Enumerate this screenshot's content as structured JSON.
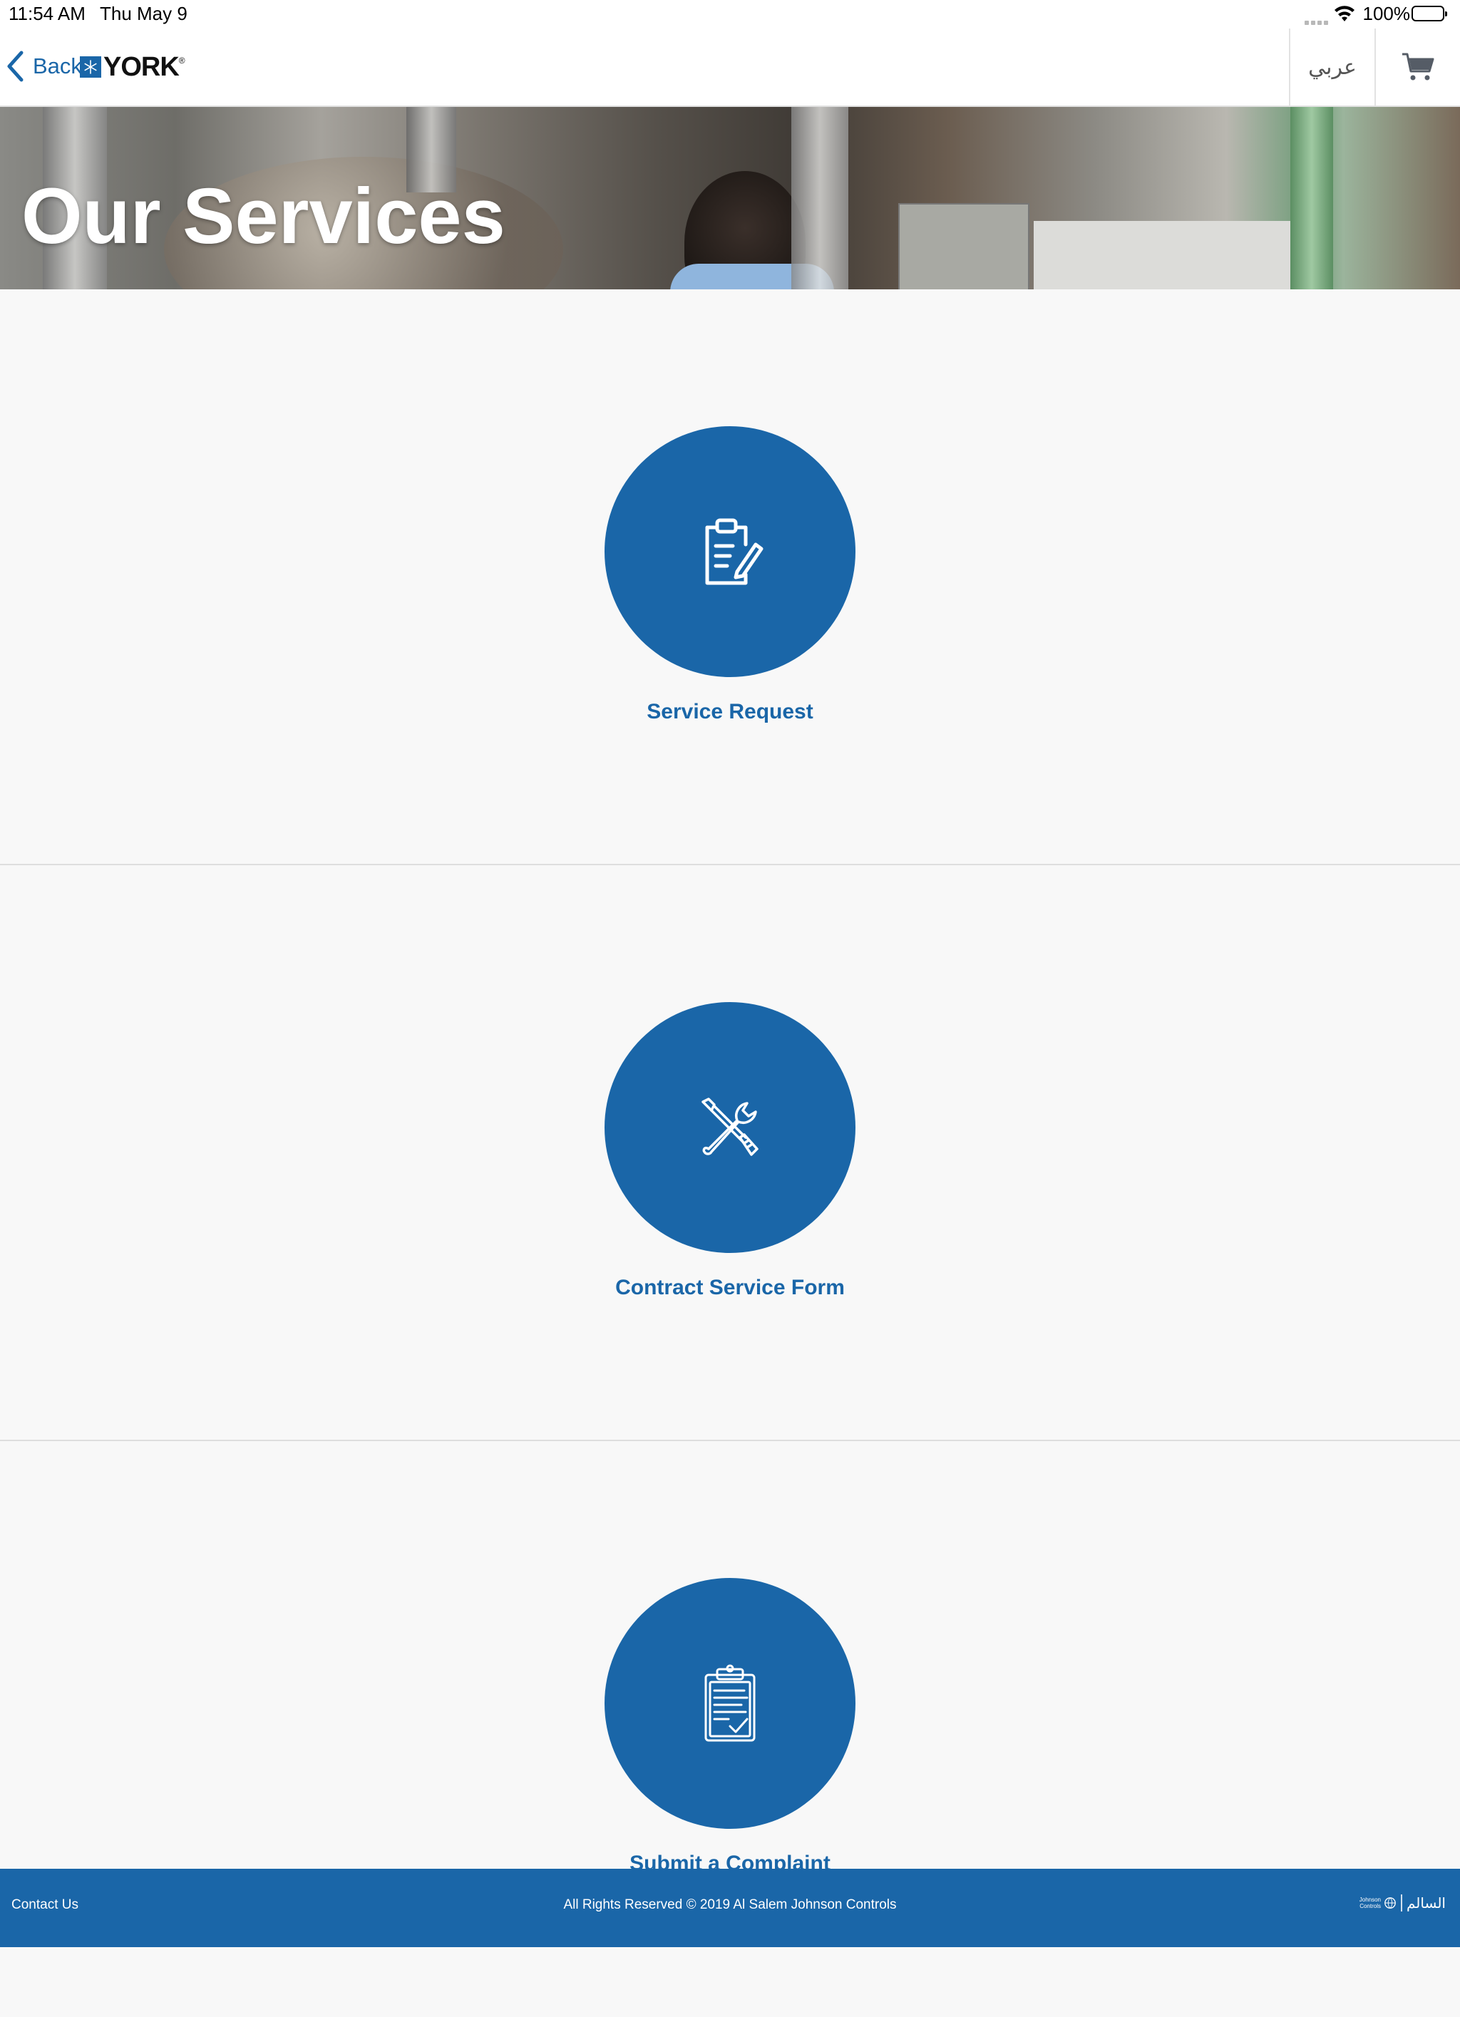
{
  "status_bar": {
    "time": "11:54 AM",
    "date": "Thu May 9",
    "battery_percent": "100%",
    "battery_level": 1.0
  },
  "nav": {
    "back_label": "Back",
    "logo_text": "YORK",
    "logo_reg": "®",
    "language_label": "عربي",
    "accent_color": "#1a66a8"
  },
  "hero": {
    "title": "Our Services"
  },
  "services": [
    {
      "label": "Service Request",
      "icon": "clipboard-edit-icon"
    },
    {
      "label": "Contract Service Form",
      "icon": "wrench-screwdriver-icon"
    },
    {
      "label": "Submit a Complaint",
      "icon": "clipboard-check-icon"
    }
  ],
  "footer": {
    "contact_label": "Contact Us",
    "copyright": "All Rights Reserved © 2019 Al Salem Johnson Controls",
    "logo_line1": "Johnson",
    "logo_line2": "Controls",
    "logo_arabic": "السالم"
  }
}
